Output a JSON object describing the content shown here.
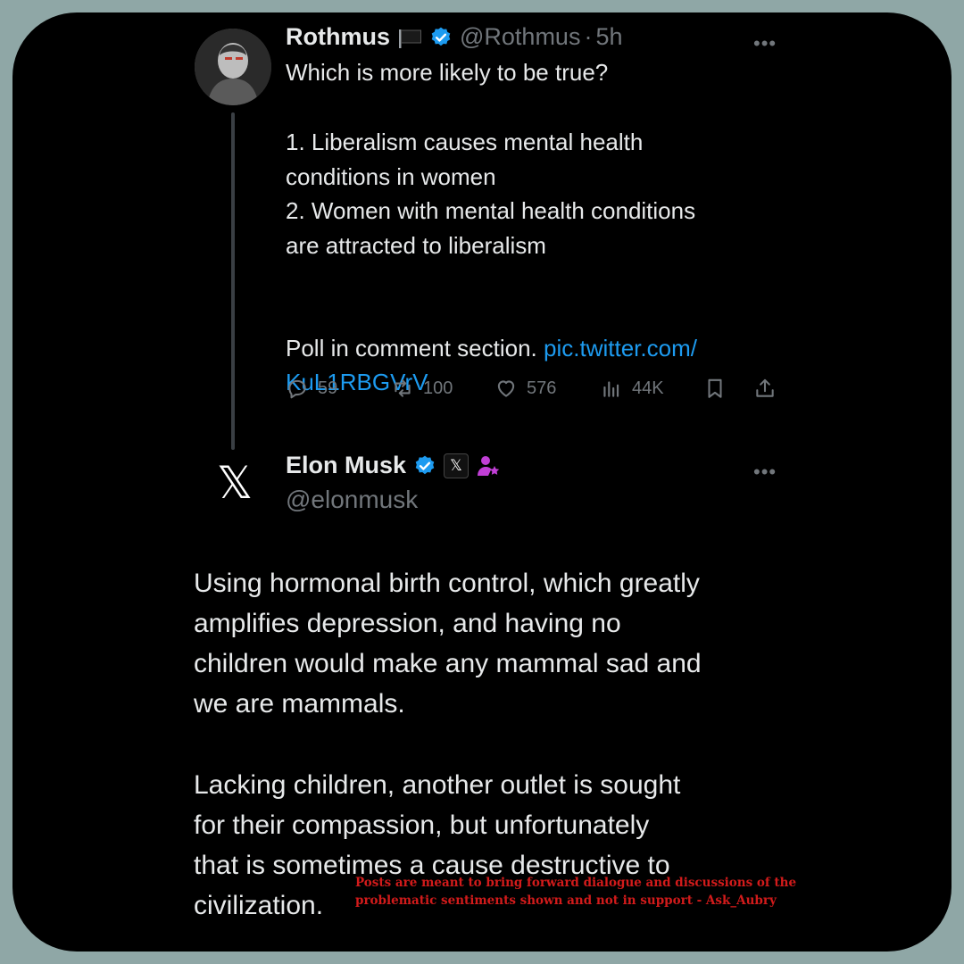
{
  "original_tweet": {
    "display_name": "Rothmus",
    "flag_emoji": "🏴",
    "handle": "@Rothmus",
    "separator": "·",
    "time": "5h",
    "more": "•••",
    "text_line1": "Which is more likely to be true?",
    "text_points": "1. Liberalism causes mental health\nconditions in women\n2. Women with mental health conditions\nare attracted to liberalism",
    "text_poll": "Poll in comment section. ",
    "link_line1": "pic.twitter.com/",
    "link_line2": "KuL1RBGVrV",
    "actions": {
      "replies": "59",
      "reposts": "100",
      "likes": "576",
      "views": "44K"
    }
  },
  "reply_tweet": {
    "display_name": "Elon Musk",
    "handle": "@elonmusk",
    "more": "•••",
    "avatar_logo": "𝕏",
    "badge_logo": "𝕏",
    "paragraph1": "Using hormonal birth control, which greatly\namplifies depression, and having no\nchildren would make any mammal sad and\nwe are mammals.",
    "paragraph2_lines": "Lacking children, another outlet is sought\nfor their compassion, but unfortunately\nthat is sometimes a cause destructive to",
    "paragraph2_last": "civilization."
  },
  "watermark": {
    "line1": "Posts are meant to bring forward dialogue and discussions of the",
    "line2": "problematic sentiments shown and not in support - Ask_Aubry"
  },
  "colors": {
    "background": "#8fa7a6",
    "card": "#000000",
    "verified": "#1d9bf0",
    "link": "#1d9bf0",
    "watermark": "#d21b1b",
    "affiliate_icon": "#c13fd6"
  },
  "icons": [
    "verified-badge-icon",
    "reply-icon",
    "repost-icon",
    "like-icon",
    "views-icon",
    "bookmark-icon",
    "share-icon",
    "x-logo-icon",
    "affiliate-person-star-icon"
  ]
}
